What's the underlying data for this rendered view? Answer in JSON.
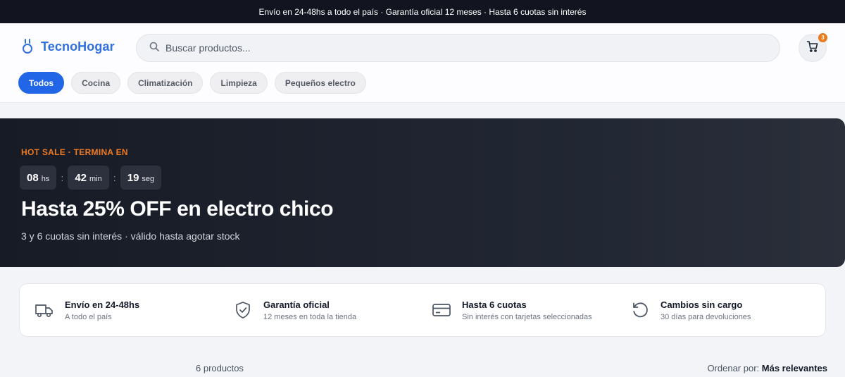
{
  "announcement": "Envío en 24-48hs a todo el país · Garantía oficial 12 meses · Hasta 6 cuotas sin interés",
  "brand": {
    "name": "TecnoHogar",
    "color": "#2f6fdf",
    "icon": "power-outlet-icon"
  },
  "search": {
    "placeholder": "Buscar productos...",
    "value": ""
  },
  "cart": {
    "count": "3"
  },
  "categories": [
    {
      "label": "Todos",
      "active": true
    },
    {
      "label": "Cocina",
      "active": false
    },
    {
      "label": "Climatización",
      "active": false
    },
    {
      "label": "Limpieza",
      "active": false
    },
    {
      "label": "Pequeños electro",
      "active": false
    }
  ],
  "hero": {
    "kicker": "HOT SALE · TERMINA EN",
    "countdown": [
      {
        "value": "08",
        "unit": "hs"
      },
      {
        "value": "42",
        "unit": "min"
      },
      {
        "value": "19",
        "unit": "seg"
      }
    ],
    "separator": ":",
    "title": "Hasta 25% OFF en electro chico",
    "subtitle": "3 y 6 cuotas sin interés · válido hasta agotar stock"
  },
  "benefits": [
    {
      "icon": "truck-icon",
      "title": "Envío en 24-48hs",
      "desc": "A todo el país"
    },
    {
      "icon": "shield-check-icon",
      "title": "Garantía oficial",
      "desc": "12 meses en toda la tienda"
    },
    {
      "icon": "credit-card-icon",
      "title": "Hasta 6 cuotas",
      "desc": "Sin interés con tarjetas seleccionadas"
    },
    {
      "icon": "refresh-icon",
      "title": "Cambios sin cargo",
      "desc": "30 días para devoluciones"
    }
  ],
  "results": {
    "count_label": "6 productos",
    "sort_prefix": "Ordenar por:",
    "sort_value": "Más relevantes"
  },
  "colors": {
    "accent": "#2166e6",
    "hot": "#f07a22",
    "hero_bg": "#1b1f29",
    "topbar": "#12151f"
  }
}
